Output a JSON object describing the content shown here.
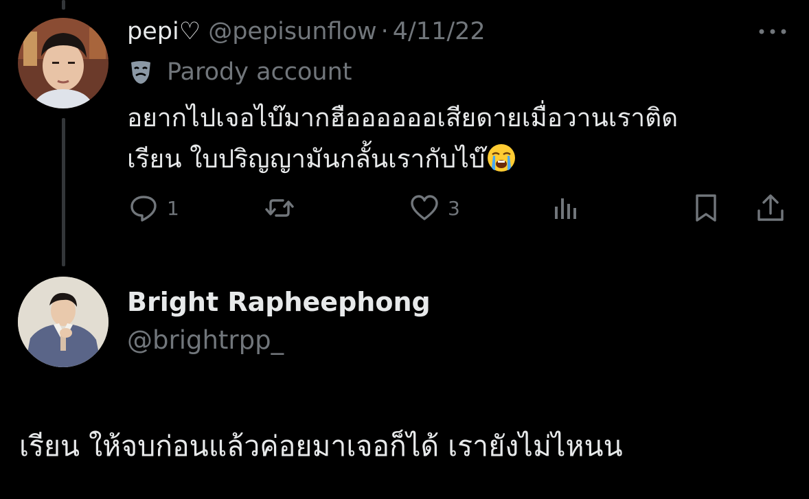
{
  "colors": {
    "background": "#000000",
    "primary_text": "#e7e9ea",
    "secondary_text": "#71767b",
    "thread_line": "#333639"
  },
  "tweet": {
    "display_name": "pepi♡",
    "handle": "@pepisunflow",
    "separator": "·",
    "date": "4/11/22",
    "more_icon": "more-horizontal-icon",
    "label_icon": "theater-mask-icon",
    "label": "Parody account",
    "text_line_1": "อยากไปเจอไบ๊มากฮืออออออเสียดายเมื่อวานเราติด",
    "text_line_2": "เรียน ใบปริญญามันกลั้นเรากับไบ๊",
    "emoji": "loudly-crying-face-emoji",
    "actions": {
      "reply": {
        "icon": "reply-icon",
        "count": "1"
      },
      "retweet": {
        "icon": "retweet-icon",
        "count": ""
      },
      "like": {
        "icon": "heart-icon",
        "count": "3"
      },
      "views": {
        "icon": "views-icon",
        "count": ""
      },
      "bookmark": {
        "icon": "bookmark-icon"
      },
      "share": {
        "icon": "share-icon"
      }
    }
  },
  "reply": {
    "display_name": "Bright Rapheephong",
    "handle": "@brightrpp_",
    "text": "เรียน ให้จบก่อนแล้วค่อยมาเจอก็ได้ เรายังไม่ไหนน"
  }
}
